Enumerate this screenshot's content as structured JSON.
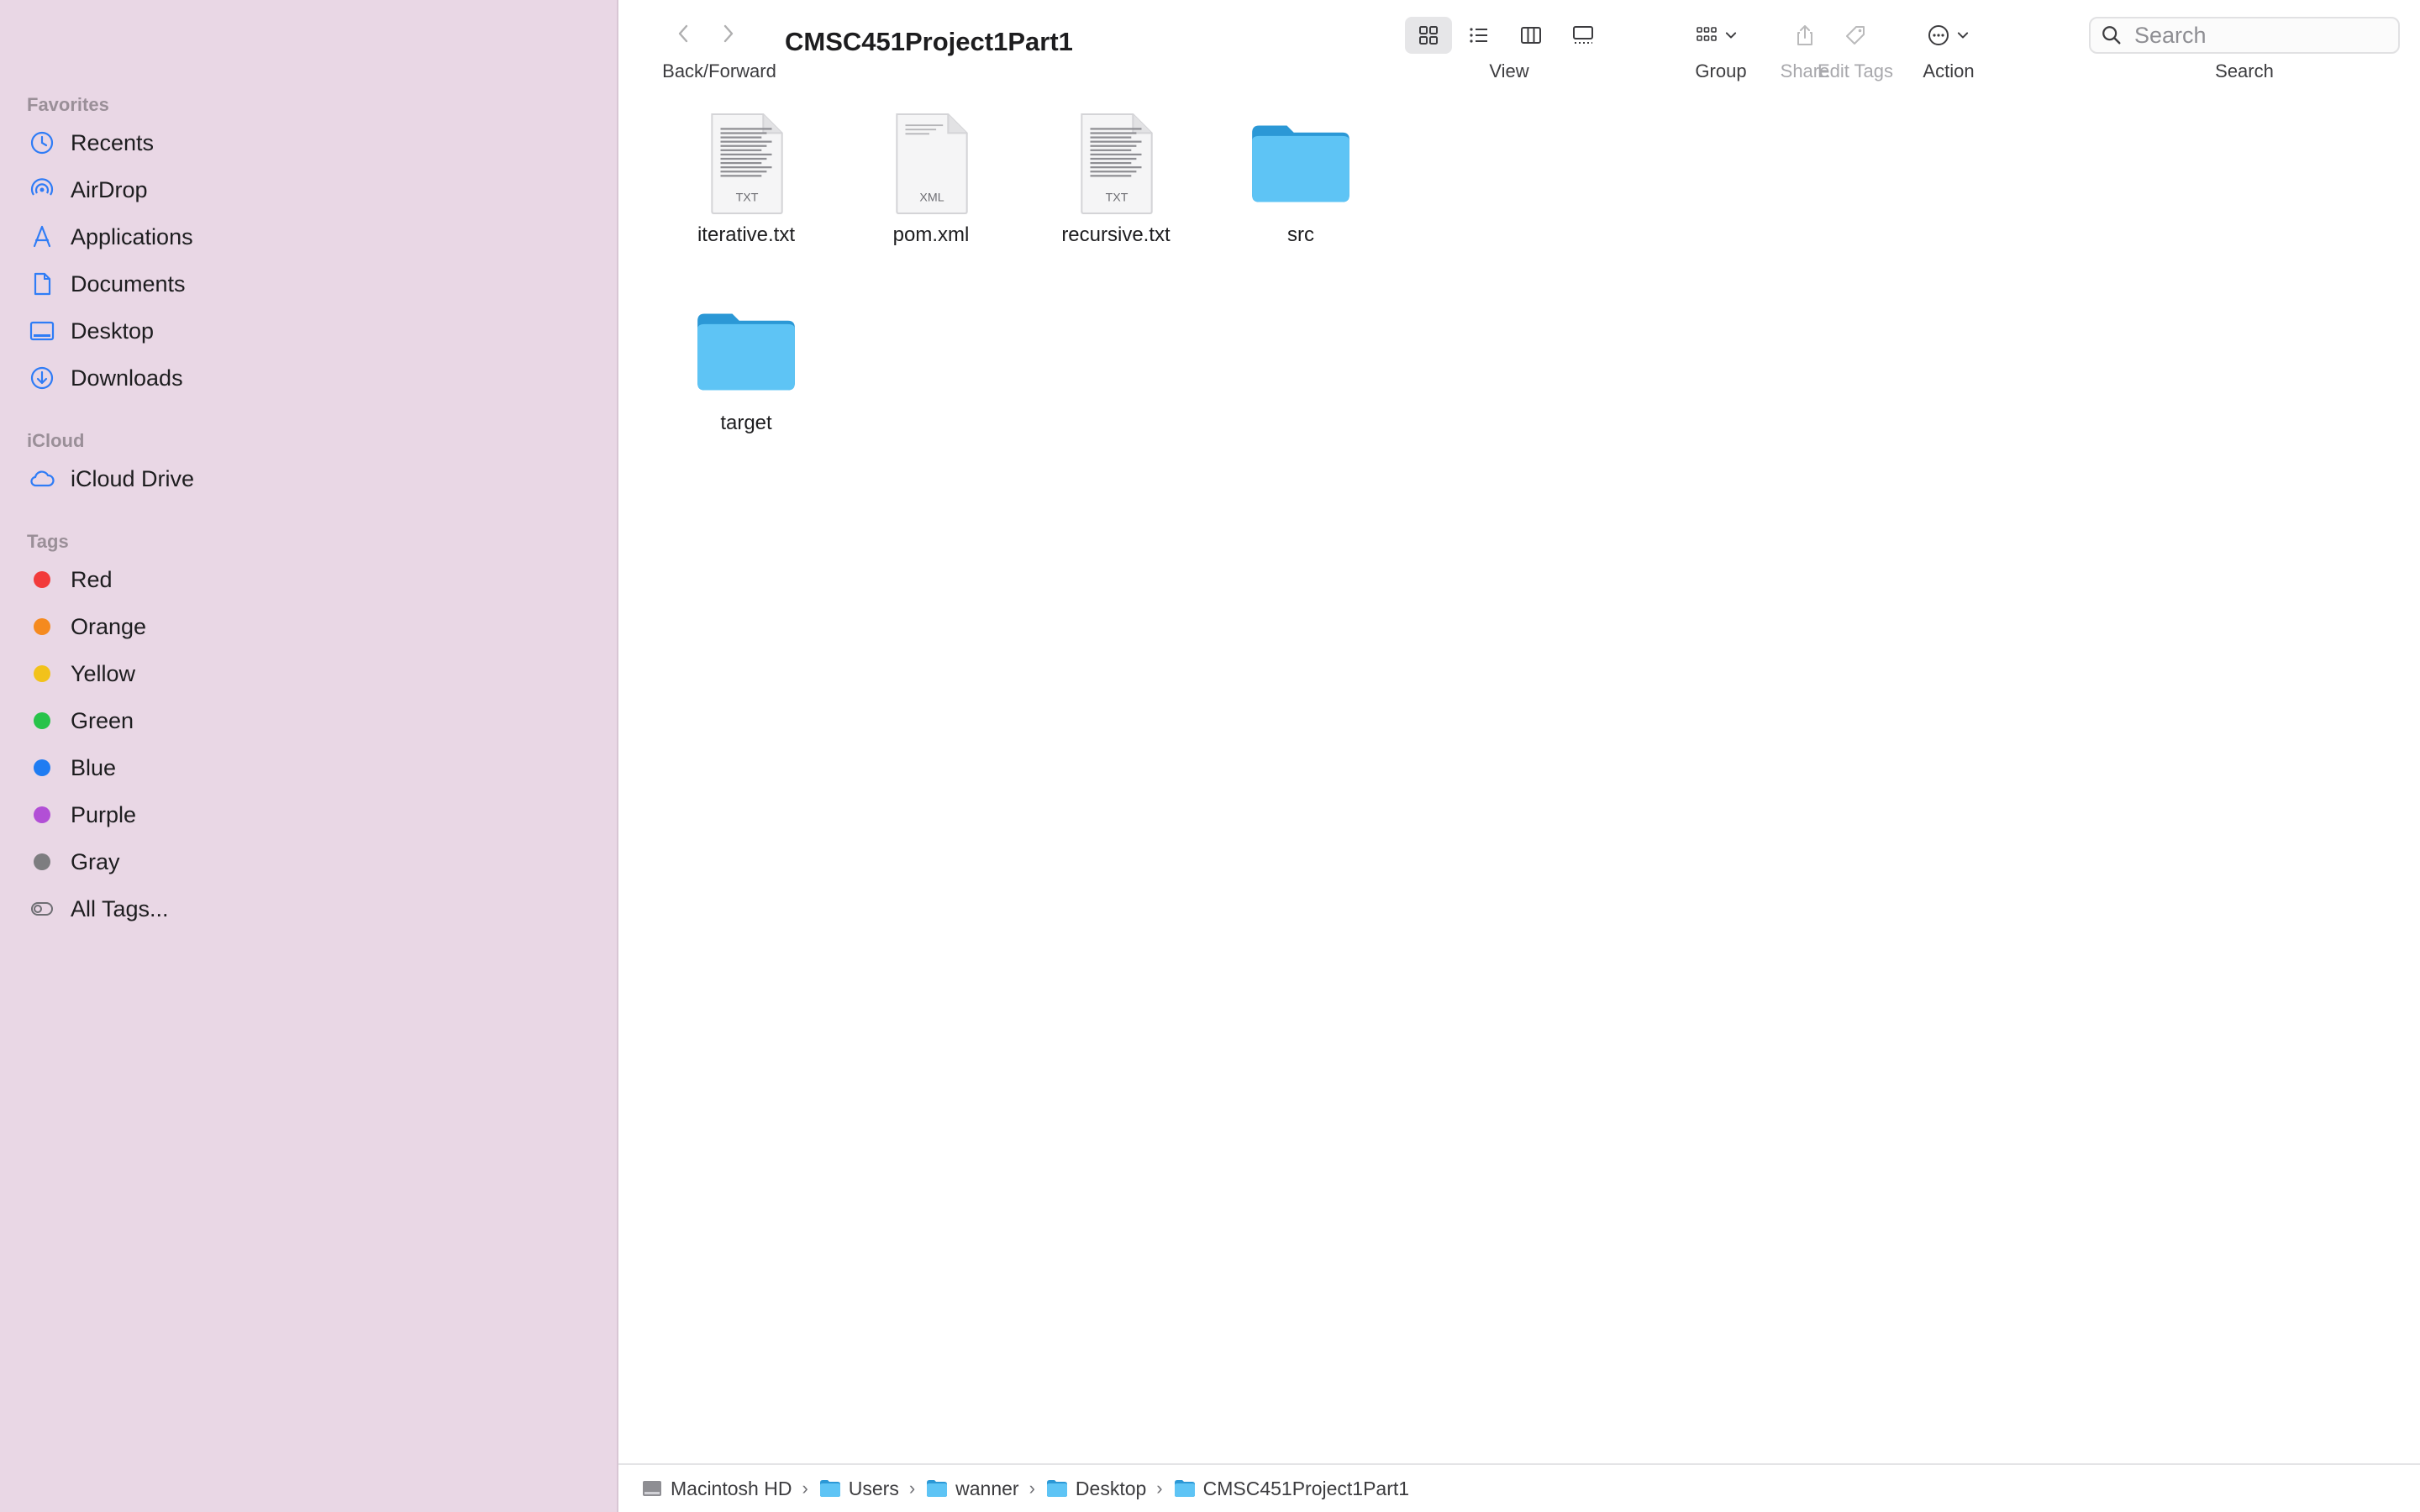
{
  "sidebar": {
    "favorites_heading": "Favorites",
    "favorites": [
      {
        "label": "Recents",
        "icon": "clock-icon"
      },
      {
        "label": "AirDrop",
        "icon": "airdrop-icon"
      },
      {
        "label": "Applications",
        "icon": "applications-icon"
      },
      {
        "label": "Documents",
        "icon": "document-icon"
      },
      {
        "label": "Desktop",
        "icon": "desktop-icon"
      },
      {
        "label": "Downloads",
        "icon": "download-icon"
      }
    ],
    "icloud_heading": "iCloud",
    "icloud": [
      {
        "label": "iCloud Drive",
        "icon": "cloud-icon"
      }
    ],
    "tags_heading": "Tags",
    "tags": [
      {
        "label": "Red",
        "color": "#f23b3b"
      },
      {
        "label": "Orange",
        "color": "#f58a1f"
      },
      {
        "label": "Yellow",
        "color": "#f2c21b"
      },
      {
        "label": "Green",
        "color": "#28c34a"
      },
      {
        "label": "Blue",
        "color": "#1f7cf2"
      },
      {
        "label": "Purple",
        "color": "#b24fd6"
      },
      {
        "label": "Gray",
        "color": "#7d7d80"
      }
    ],
    "all_tags": "All Tags..."
  },
  "toolbar": {
    "back_forward_label": "Back/Forward",
    "title": "CMSC451Project1Part1",
    "view_label": "View",
    "group_label": "Group",
    "share_label": "Share",
    "edit_tags_label": "Edit Tags",
    "action_label": "Action",
    "search_label": "Search",
    "search_placeholder": "Search"
  },
  "files": [
    {
      "name": "iterative.txt",
      "kind": "txt",
      "badge": "TXT"
    },
    {
      "name": "pom.xml",
      "kind": "xml",
      "badge": "XML"
    },
    {
      "name": "recursive.txt",
      "kind": "txt",
      "badge": "TXT"
    },
    {
      "name": "src",
      "kind": "folder"
    },
    {
      "name": "target",
      "kind": "folder"
    }
  ],
  "pathbar": [
    "Macintosh HD",
    "Users",
    "wanner",
    "Desktop",
    "CMSC451Project1Part1"
  ],
  "colors": {
    "sidebar_bg": "#e9d7e5",
    "accent": "#3a82f7",
    "folder_blue": "#5ec4f5"
  }
}
